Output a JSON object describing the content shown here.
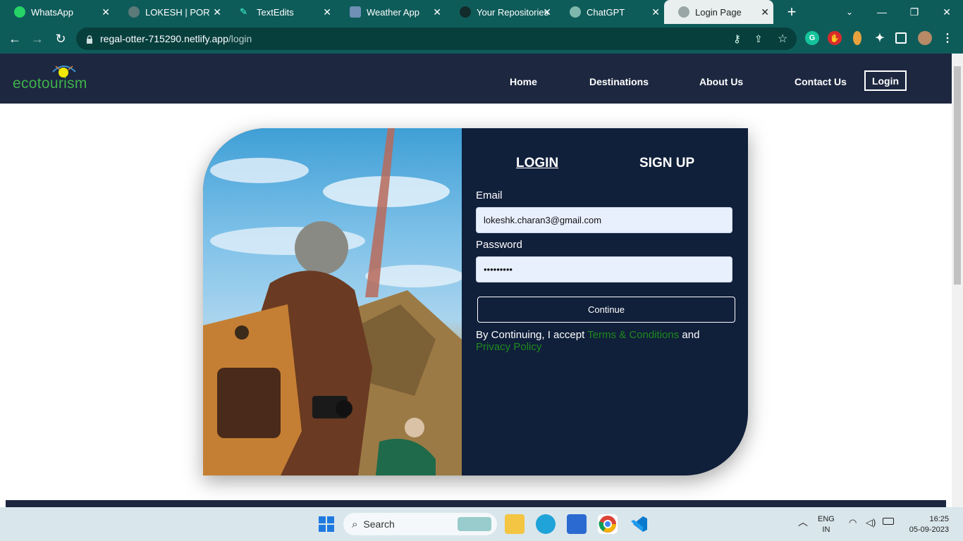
{
  "browser": {
    "tabs": [
      {
        "label": "WhatsApp",
        "icon": "whatsapp-icon",
        "color": "#25d366"
      },
      {
        "label": "LOKESH | PORTFO",
        "icon": "globe-icon",
        "color": "#9aa"
      },
      {
        "label": "TextEdits",
        "icon": "pen-icon",
        "color": "#3ac"
      },
      {
        "label": "Weather App",
        "icon": "weather-icon",
        "color": "#68a"
      },
      {
        "label": "Your Repositories",
        "icon": "github-icon",
        "color": "#111"
      },
      {
        "label": "ChatGPT",
        "icon": "chatgpt-icon",
        "color": "#7ac"
      },
      {
        "label": "Login Page",
        "icon": "globe-icon",
        "color": "#888"
      }
    ],
    "new_tab": "+",
    "url_host": "regal-otter-715290.netlify.app",
    "url_path": "/login"
  },
  "site": {
    "logo_text": "ecotourism",
    "nav": [
      "Home",
      "Destinations",
      "About Us",
      "Contact Us"
    ],
    "login_button": "Login"
  },
  "form": {
    "tab_login": "LOGIN",
    "tab_signup": "SIGN UP",
    "email_label": "Email",
    "email_value": "lokeshk.charan3@gmail.com",
    "password_label": "Password",
    "password_value": "•••••••••",
    "continue_label": "Continue",
    "terms_prefix": "By Continuing, I accept ",
    "terms_link": "Terms & Conditions",
    "terms_mid": " and",
    "privacy_link": "Privacy Policy"
  },
  "taskbar": {
    "search_placeholder": "Search",
    "lang_line1": "ENG",
    "lang_line2": "IN",
    "time": "16:25",
    "date": "05-09-2023"
  }
}
